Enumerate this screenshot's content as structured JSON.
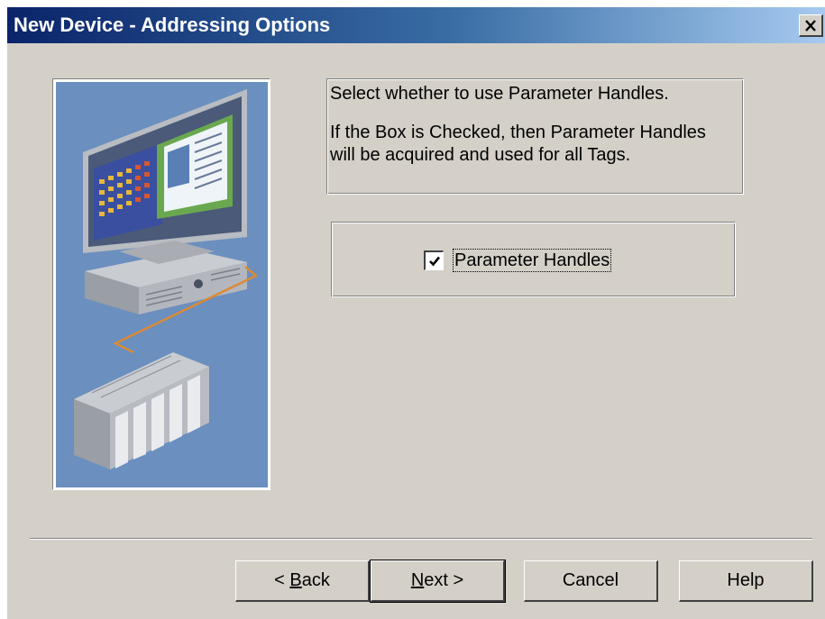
{
  "window": {
    "title": "New Device - Addressing Options"
  },
  "info": {
    "line1": "Select whether to use Parameter Handles.",
    "line2": "If the Box is Checked, then Parameter Handles",
    "line3": "will be acquired and used for all Tags."
  },
  "option": {
    "label": "Parameter Handles",
    "checked": true
  },
  "buttons": {
    "back": {
      "prefix": "< ",
      "mnemonic": "B",
      "rest": "ack"
    },
    "next": {
      "mnemonic": "N",
      "rest": "ext >"
    },
    "cancel": "Cancel",
    "help": "Help"
  },
  "icons": {
    "close": "close-icon",
    "check": "checkmark-icon",
    "illustration": "computer-plc-network-illustration"
  },
  "colors": {
    "dialog_bg": "#d4d0c8",
    "title_start": "#0a246a",
    "title_end": "#a6caf0",
    "illustration_bg": "#6b8fbf"
  }
}
